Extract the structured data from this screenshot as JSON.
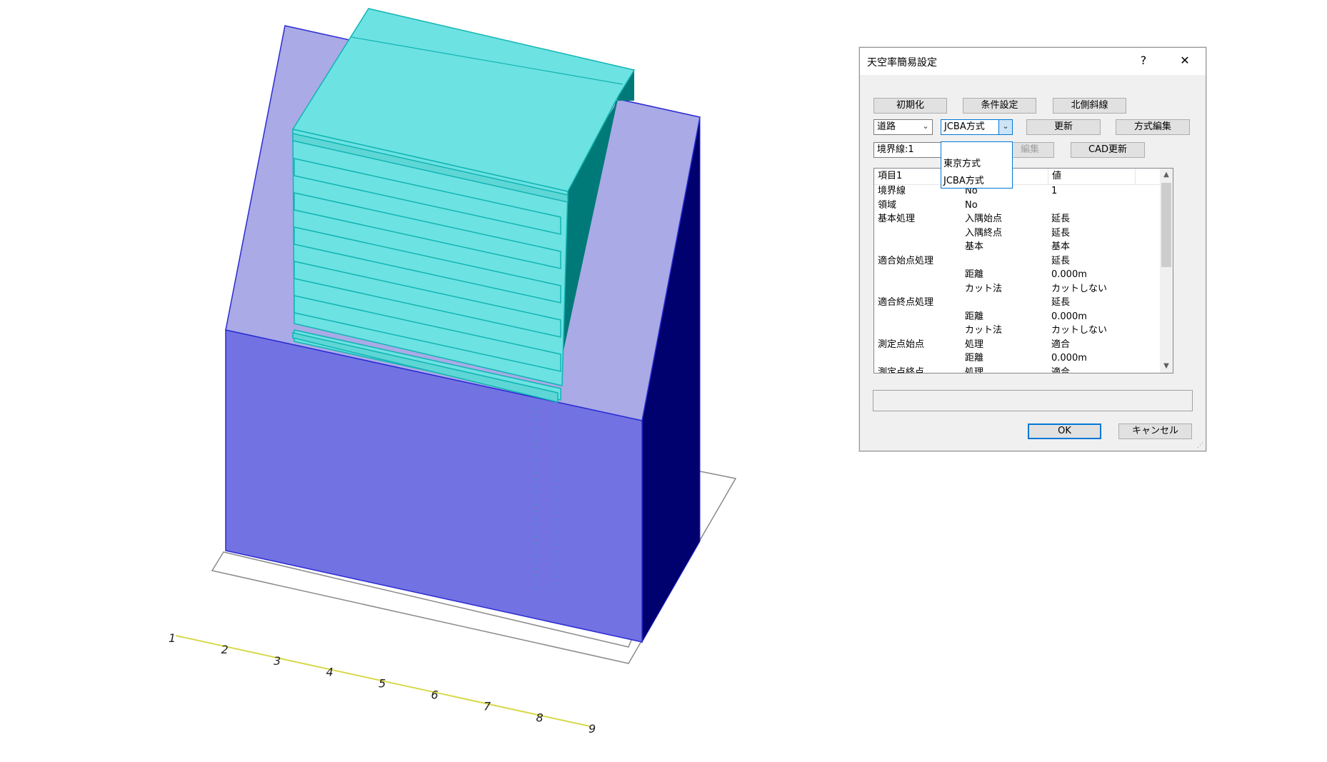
{
  "viewport": {
    "ruler_labels": [
      "1",
      "2",
      "3",
      "4",
      "5",
      "6",
      "7",
      "8",
      "9"
    ],
    "colors": {
      "building_front": "#7272e2",
      "building_side": "#00006e",
      "roof_plane": "#a9aae6",
      "edge": "#2a2ad4",
      "volume_top": "#6de2e2",
      "volume_side": "#007a78",
      "volume_edge": "#11b4b4",
      "ground_outline": "#8a8a8a",
      "ruler_line": "#d8d84a"
    }
  },
  "dialog": {
    "title": "天空率簡易設定",
    "help_label": "?",
    "close_label": "✕",
    "buttons": {
      "init": "初期化",
      "conditions": "条件設定",
      "north_slope": "北側斜線",
      "update": "更新",
      "method_edit": "方式編集",
      "boundary_edit_partial": "編集",
      "cad_update": "CAD更新",
      "ok": "OK",
      "cancel": "キャンセル"
    },
    "combo_type": {
      "value": "道路"
    },
    "combo_method": {
      "value": "JCBA方式"
    },
    "dropdown_options": [
      "東京方式",
      "JCBA方式"
    ],
    "boundary_field": "境界線:1",
    "list": {
      "headers": [
        "項目1",
        "",
        "値"
      ],
      "rows": [
        [
          "境界線",
          "No",
          "1"
        ],
        [
          "領域",
          "No",
          ""
        ],
        [
          "基本処理",
          "入隅始点",
          "延長"
        ],
        [
          "",
          "入隅終点",
          "延長"
        ],
        [
          "",
          "基本",
          "基本"
        ],
        [
          "適合始点処理",
          "",
          "延長"
        ],
        [
          "",
          "距離",
          "0.000m"
        ],
        [
          "",
          "カット法",
          "カットしない"
        ],
        [
          "適合終点処理",
          "",
          "延長"
        ],
        [
          "",
          "距離",
          "0.000m"
        ],
        [
          "",
          "カット法",
          "カットしない"
        ],
        [
          "測定点始点",
          "処理",
          "適合"
        ],
        [
          "",
          "距離",
          "0.000m"
        ],
        [
          "測定点終点",
          "処理",
          "適合"
        ]
      ]
    },
    "status_text": ""
  }
}
